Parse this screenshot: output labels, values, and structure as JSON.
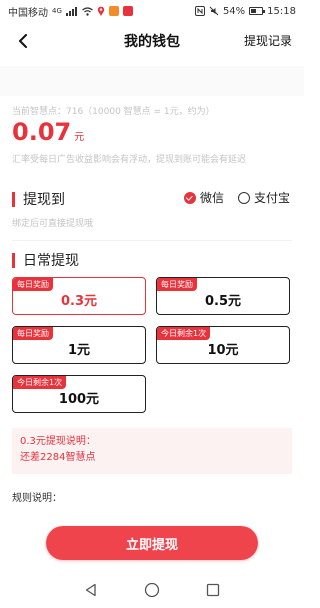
{
  "status_bar": {
    "carrier": "中国移动",
    "network": "4G",
    "battery": "54%",
    "battery_level": 0.54,
    "time": "15:18"
  },
  "header": {
    "title": "我的钱包",
    "right_action": "提现记录"
  },
  "wallet": {
    "points_line": "当前智慧点：716（10000 智慧点 = 1元，约为）",
    "amount": "0.07",
    "unit": "元",
    "rate_note": "汇率受每日广告收益影响会有浮动，提现到账可能会有延迟"
  },
  "withdraw_to": {
    "title": "提现到",
    "methods": [
      {
        "label": "微信",
        "selected": true
      },
      {
        "label": "支付宝",
        "selected": false
      }
    ],
    "bind_note": "绑定后可直接提现哦"
  },
  "daily": {
    "title": "日常提现",
    "options": [
      {
        "tag": "每日奖励",
        "value": "0.3元",
        "selected": true
      },
      {
        "tag": "每日奖励",
        "value": "0.5元",
        "selected": false
      },
      {
        "tag": "每日奖励",
        "value": "1元",
        "selected": false
      },
      {
        "tag": "今日剩余1次",
        "value": "10元",
        "selected": false
      },
      {
        "tag": "今日剩余1次",
        "value": "100元",
        "selected": false
      }
    ]
  },
  "explain": {
    "line1": "0.3元提现说明：",
    "line2": "还差2284智慧点"
  },
  "rules": {
    "title": "规则说明："
  },
  "action": {
    "button": "立即提现"
  },
  "colors": {
    "accent": "#e8333c",
    "button": "#f0444c",
    "hint": "#c4c4c4"
  }
}
